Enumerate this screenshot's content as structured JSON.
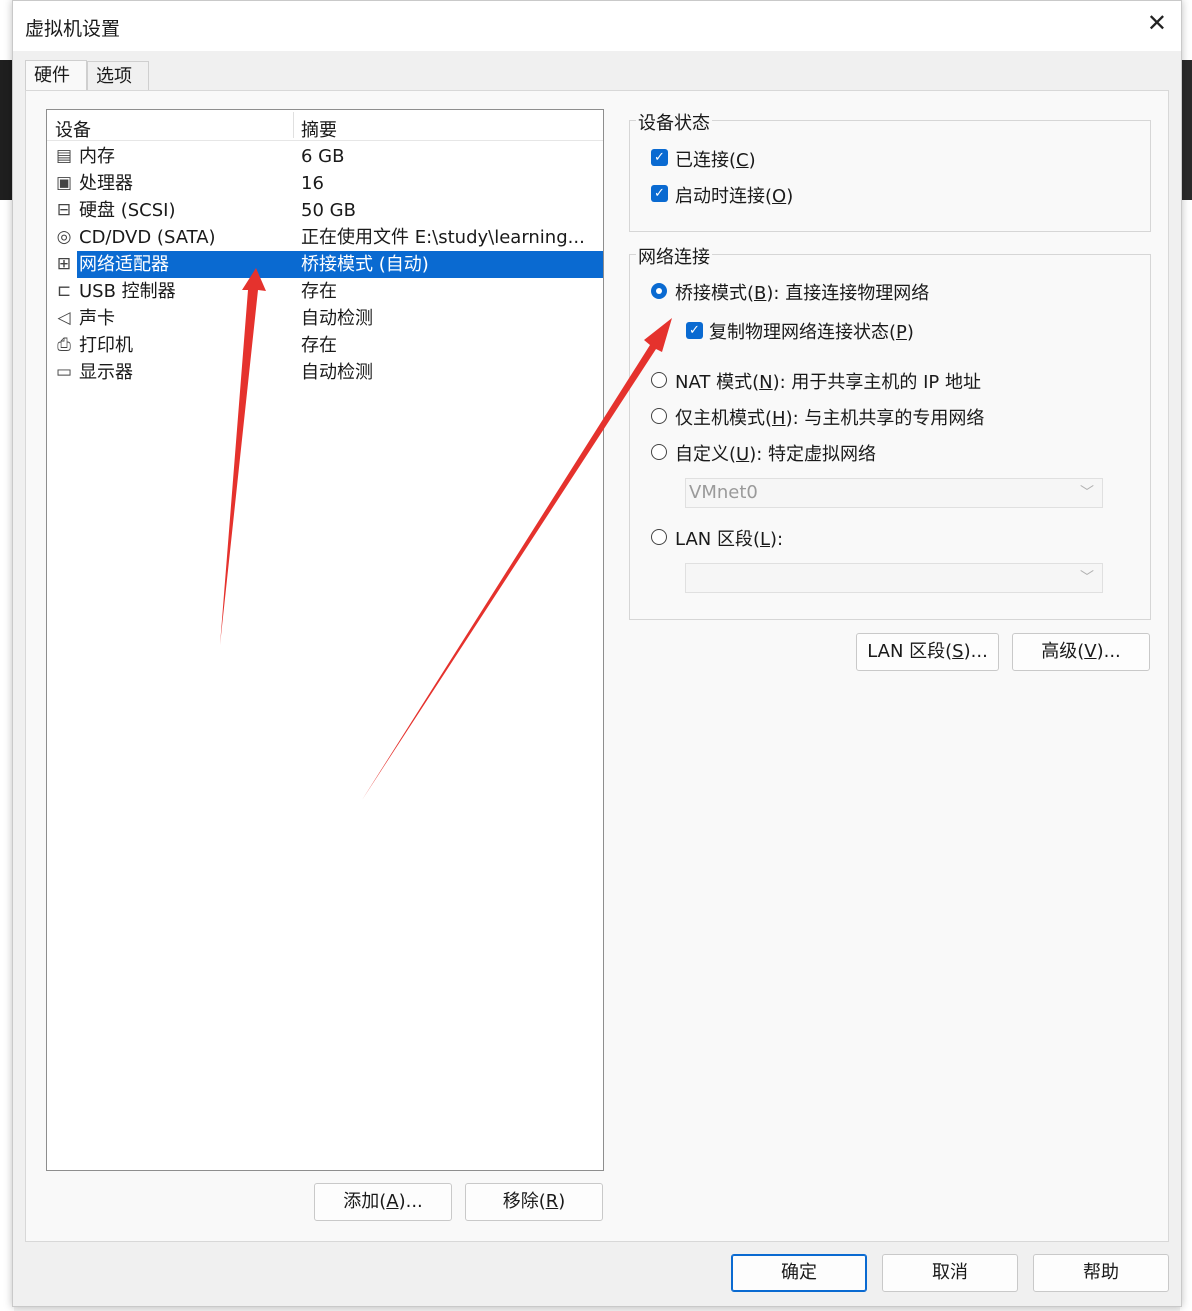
{
  "window": {
    "title": "虚拟机设置",
    "close_glyph": "✕"
  },
  "tabs": [
    {
      "label": "硬件"
    },
    {
      "label": "选项"
    }
  ],
  "device_list": {
    "headers": {
      "device": "设备",
      "summary": "摘要"
    },
    "rows": [
      {
        "icon": "memory-icon",
        "name": "内存",
        "summary": "6 GB"
      },
      {
        "icon": "processor-icon",
        "name": "处理器",
        "summary": "16"
      },
      {
        "icon": "hard-disk-icon",
        "name": "硬盘 (SCSI)",
        "summary": "50 GB"
      },
      {
        "icon": "cd-dvd-icon",
        "name": "CD/DVD (SATA)",
        "summary": "正在使用文件 E:\\study\\learning..."
      },
      {
        "icon": "network-adapter-icon",
        "name": "网络适配器",
        "summary": "桥接模式 (自动)",
        "selected": true
      },
      {
        "icon": "usb-icon",
        "name": "USB 控制器",
        "summary": "存在"
      },
      {
        "icon": "sound-icon",
        "name": "声卡",
        "summary": "自动检测"
      },
      {
        "icon": "printer-icon",
        "name": "打印机",
        "summary": "存在"
      },
      {
        "icon": "display-icon",
        "name": "显示器",
        "summary": "自动检测"
      }
    ]
  },
  "list_buttons": {
    "add": {
      "text": "添加(",
      "key": "A",
      "suffix": ")..."
    },
    "remove": {
      "text": "移除(",
      "key": "R",
      "suffix": ")"
    }
  },
  "device_status": {
    "label": "设备状态",
    "connected": {
      "text": "已连接(",
      "key": "C",
      "suffix": ")",
      "checked": true
    },
    "connect_at_power_on": {
      "text": "启动时连接(",
      "key": "O",
      "suffix": ")",
      "checked": true
    }
  },
  "network": {
    "label": "网络连接",
    "bridged": {
      "text": "桥接模式(",
      "key": "B",
      "suffix": "): 直接连接物理网络",
      "selected": true
    },
    "replicate": {
      "text": "复制物理网络连接状态(",
      "key": "P",
      "suffix": ")",
      "checked": true
    },
    "nat": {
      "text": "NAT 模式(",
      "key": "N",
      "suffix": "): 用于共享主机的 IP 地址",
      "selected": false
    },
    "host_only": {
      "text": "仅主机模式(",
      "key": "H",
      "suffix": "): 与主机共享的专用网络",
      "selected": false
    },
    "custom": {
      "text": "自定义(",
      "key": "U",
      "suffix": "): 特定虚拟网络",
      "selected": false
    },
    "custom_value": "VMnet0",
    "lan_segment": {
      "text": "LAN 区段(",
      "key": "L",
      "suffix": "):",
      "selected": false
    },
    "lan_value": ""
  },
  "network_buttons": {
    "lan_segments": {
      "text": "LAN 区段(",
      "key": "S",
      "suffix": ")..."
    },
    "advanced": {
      "text": "高级(",
      "key": "V",
      "suffix": ")..."
    }
  },
  "footer": {
    "ok": "确定",
    "cancel": "取消",
    "help": "帮助"
  },
  "colors": {
    "accent": "#0a6ad1",
    "annotation_arrow": "#e5322d"
  }
}
